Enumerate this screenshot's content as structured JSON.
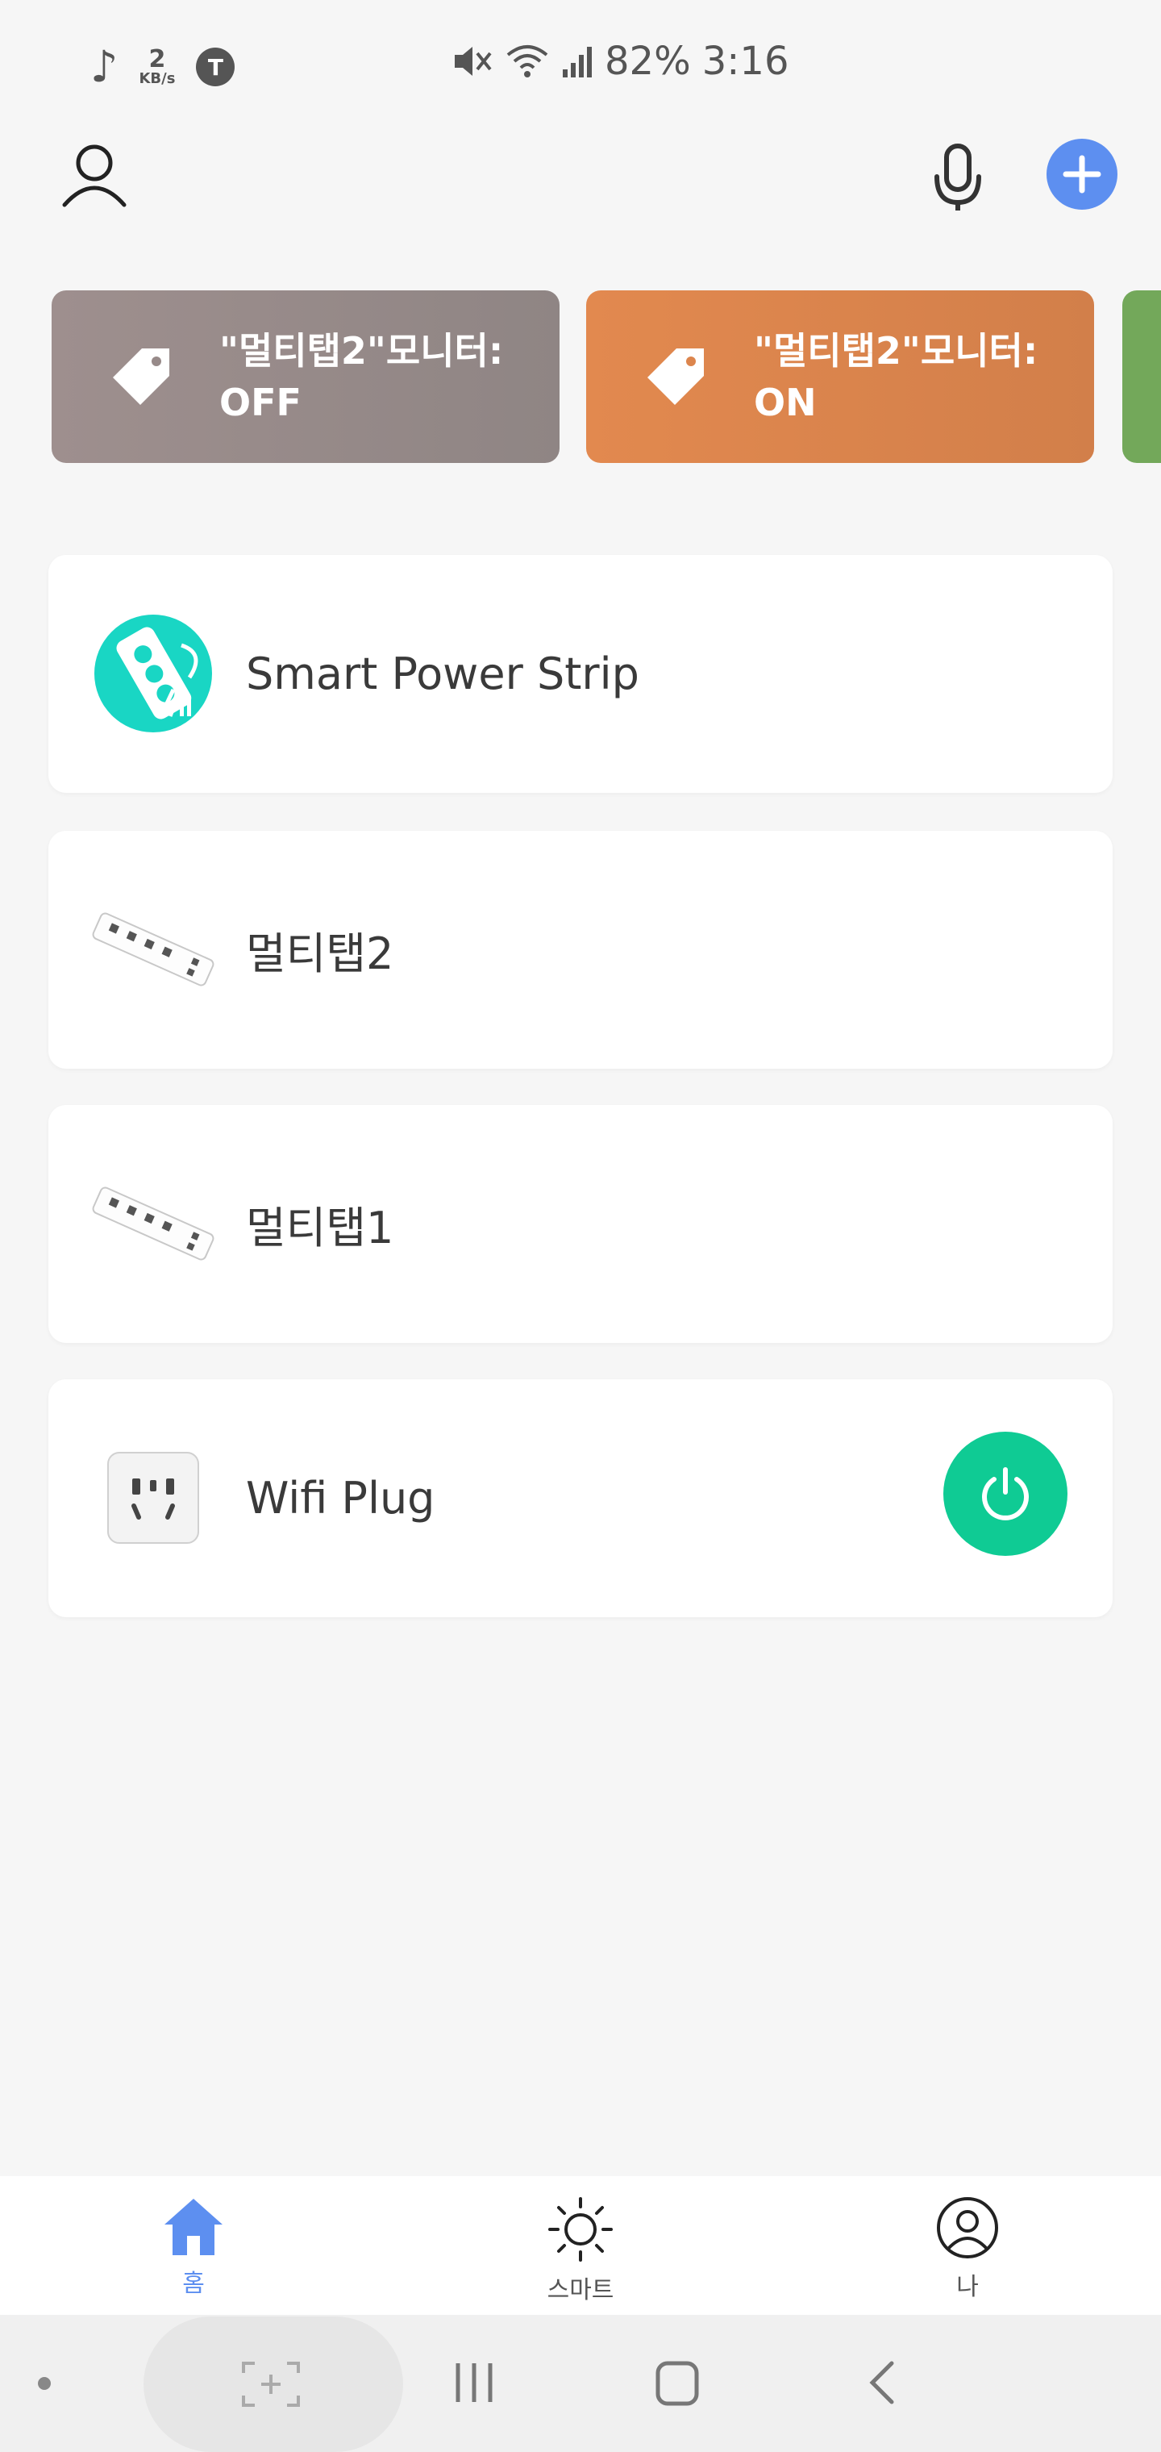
{
  "status_bar": {
    "music": "♪",
    "speed_value": "2",
    "speed_unit": "KB/s",
    "carrier_badge": "T",
    "battery": "82%",
    "time": "3:16",
    "icons": [
      "music-note-icon",
      "mute-icon",
      "wifi-icon",
      "signal-icon"
    ]
  },
  "header": {
    "icons": [
      "user-icon",
      "microphone-icon",
      "add-icon"
    ],
    "add_color": "#5d8ff0"
  },
  "scenes": [
    {
      "label": "\"멀티탭2\"모니터:\nOFF",
      "color": "#978a89",
      "icon": "tag-icon"
    },
    {
      "label": "\"멀티탭2\"모니터:\nON",
      "color": "#dc854d",
      "icon": "tag-icon"
    },
    {
      "label": "",
      "color": "#73a85a",
      "icon": "tag-icon"
    }
  ],
  "devices": [
    {
      "name": "Smart Power Strip",
      "icon": "power-strip-icon"
    },
    {
      "name": "멀티탭2",
      "icon": "multitap-image"
    },
    {
      "name": "멀티탭1",
      "icon": "multitap-image"
    },
    {
      "name": "Wifi Plug",
      "icon": "plug-icon",
      "power_on": true,
      "power_color": "#0fcb94"
    }
  ],
  "bottom_nav": {
    "items": [
      {
        "label": "홈",
        "icon": "home-icon",
        "active": true
      },
      {
        "label": "스마트",
        "icon": "sun-icon",
        "active": false
      },
      {
        "label": "나",
        "icon": "profile-icon",
        "active": false
      }
    ],
    "active_color": "#5d8ff0"
  },
  "system_nav": {
    "icons": [
      "dot-icon",
      "scan-icon",
      "recents-icon",
      "home-button-icon",
      "back-icon"
    ]
  }
}
